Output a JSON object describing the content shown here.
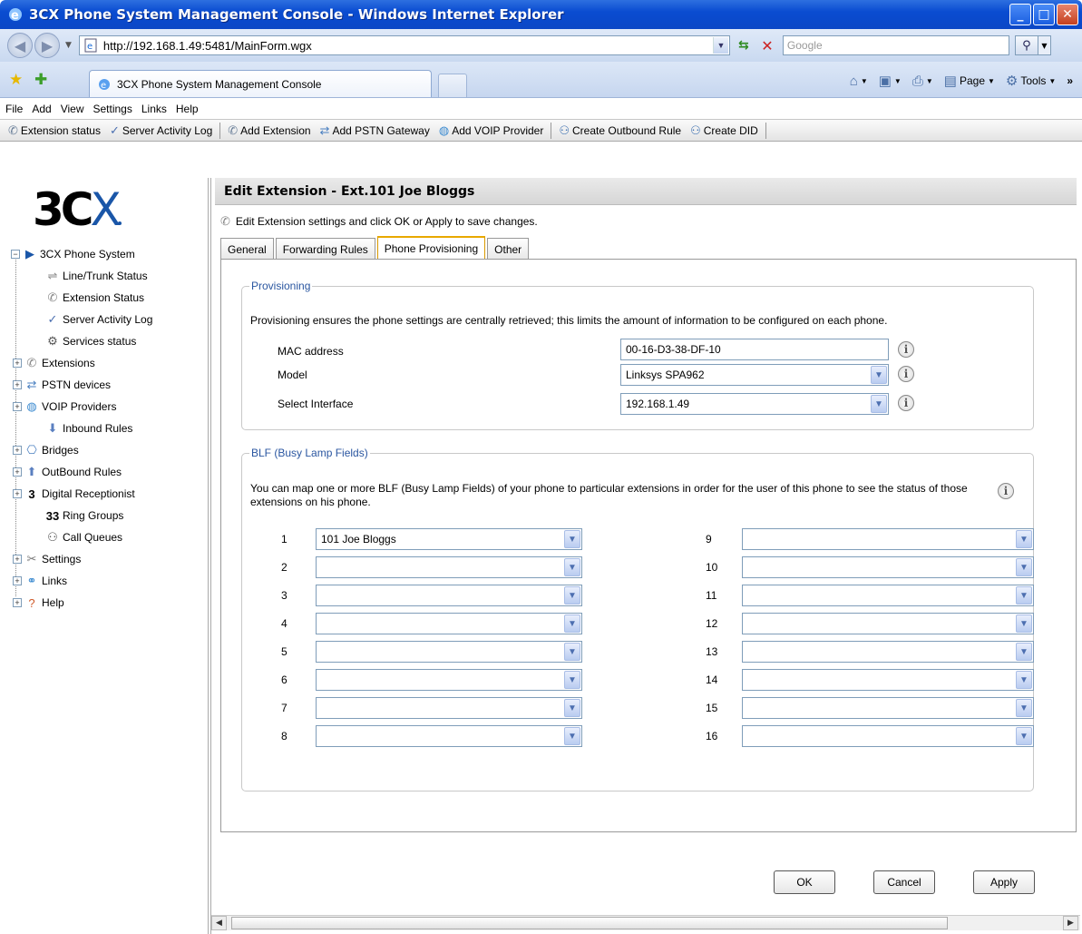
{
  "window": {
    "title": "3CX Phone System Management Console - Windows Internet Explorer"
  },
  "addressbar": {
    "url": "http://192.168.1.49:5481/MainForm.wgx",
    "search_placeholder": "Google"
  },
  "browser_tab": {
    "title": "3CX Phone System Management Console"
  },
  "command_bar": {
    "page_label": "Page",
    "tools_label": "Tools"
  },
  "menu": {
    "items": [
      "File",
      "Add",
      "View",
      "Settings",
      "Links",
      "Help"
    ]
  },
  "toolbar": {
    "extension_status": "Extension status",
    "server_activity_log": "Server Activity Log",
    "add_extension": "Add Extension",
    "add_pstn_gateway": "Add PSTN Gateway",
    "add_voip_provider": "Add VOIP Provider",
    "create_outbound_rule": "Create Outbound Rule",
    "create_did": "Create DID"
  },
  "sidebar": {
    "logo": "3CX",
    "root": "3CX Phone System",
    "items": [
      "Line/Trunk Status",
      "Extension Status",
      "Server Activity Log",
      "Services status",
      "Extensions",
      "PSTN devices",
      "VOIP Providers",
      "Inbound Rules",
      "Bridges",
      "OutBound Rules",
      "Digital Receptionist",
      "Ring Groups",
      "Call Queues",
      "Settings",
      "Links",
      "Help"
    ]
  },
  "main": {
    "title": "Edit Extension - Ext.101 Joe Bloggs",
    "subtitle": "Edit Extension settings and click OK or Apply to save changes.",
    "tabs": [
      "General",
      "Forwarding Rules",
      "Phone Provisioning",
      "Other"
    ],
    "active_tab": "Phone Provisioning"
  },
  "provisioning": {
    "legend": "Provisioning",
    "description": "Provisioning ensures the phone settings are centrally retrieved; this limits the amount of information to be configured on each phone.",
    "mac_label": "MAC address",
    "mac_value": "00-16-D3-38-DF-10",
    "model_label": "Model",
    "model_value": "Linksys SPA962",
    "interface_label": "Select Interface",
    "interface_value": "192.168.1.49"
  },
  "blf": {
    "legend": "BLF (Busy Lamp Fields)",
    "description": "You can map one or more BLF (Busy Lamp Fields) of your phone to particular extensions in order for the user of this phone to see the status of those extensions on his phone.",
    "left": [
      {
        "num": "1",
        "value": "101 Joe Bloggs"
      },
      {
        "num": "2",
        "value": ""
      },
      {
        "num": "3",
        "value": ""
      },
      {
        "num": "4",
        "value": ""
      },
      {
        "num": "5",
        "value": ""
      },
      {
        "num": "6",
        "value": ""
      },
      {
        "num": "7",
        "value": ""
      },
      {
        "num": "8",
        "value": ""
      }
    ],
    "right": [
      {
        "num": "9",
        "value": ""
      },
      {
        "num": "10",
        "value": ""
      },
      {
        "num": "11",
        "value": ""
      },
      {
        "num": "12",
        "value": ""
      },
      {
        "num": "13",
        "value": ""
      },
      {
        "num": "14",
        "value": ""
      },
      {
        "num": "15",
        "value": ""
      },
      {
        "num": "16",
        "value": ""
      }
    ]
  },
  "buttons": {
    "ok": "OK",
    "cancel": "Cancel",
    "apply": "Apply"
  }
}
